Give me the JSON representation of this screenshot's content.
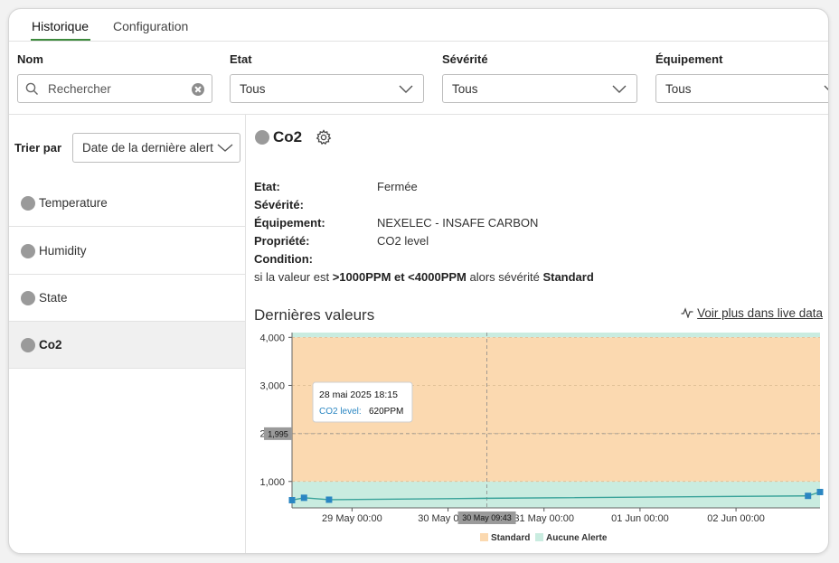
{
  "tabs": {
    "historique": "Historique",
    "configuration": "Configuration"
  },
  "filters": {
    "nom_label": "Nom",
    "etat_label": "Etat",
    "severite_label": "Sévérité",
    "equipement_label": "Équipement",
    "search_placeholder": "Rechercher",
    "etat_value": "Tous",
    "severite_value": "Tous",
    "equipement_value": "Tous"
  },
  "sidebar": {
    "sort_label": "Trier par",
    "sort_value": "Date de la dernière alerte",
    "items": [
      {
        "label": "Temperature"
      },
      {
        "label": "Humidity"
      },
      {
        "label": "State"
      },
      {
        "label": "Co2"
      }
    ]
  },
  "detail": {
    "title": "Co2",
    "etat_label": "Etat:",
    "etat_value": "Fermée",
    "severite_label": "Sévérité:",
    "equipement_label": "Équipement:",
    "equipement_value": "NEXELEC - INSAFE CARBON",
    "propriete_label": "Propriété:",
    "propriete_value": "CO2 level",
    "condition_label": "Condition:",
    "cond_prefix": "si la valeur est",
    "cond_range": ">1000PPM et <4000PPM",
    "cond_mid": "alors sévérité",
    "cond_severity": "Standard",
    "last_values_title": "Dernières valeurs",
    "live_link_icon": "activity-icon",
    "live_link": "Voir plus dans live data"
  },
  "colors": {
    "accent": "#3d8a3d",
    "standard_band": "#fbd9b0",
    "no_alert_band": "#c9ece0",
    "series": "#3aa39a",
    "marker": "#2a86c2",
    "tooltip_series": "#2a86c2"
  },
  "chart_data": {
    "type": "line",
    "x_ticks": [
      "29 May 00:00",
      "30 May 00:00",
      "31 May 00:00",
      "01 Jun 00:00",
      "02 Jun 00:00"
    ],
    "y_ticks": [
      "1,000",
      "2,000",
      "3,000",
      "4,000"
    ],
    "ylim": [
      450,
      4100
    ],
    "xlim": [
      "2025-05-28 09:00",
      "2025-06-02 21:00"
    ],
    "bands": [
      {
        "name": "Standard",
        "from": 1000,
        "to": 4000
      },
      {
        "name": "Aucune Alerte",
        "from": 450,
        "to": 1000
      },
      {
        "name": "Aucune Alerte",
        "from": 4000,
        "to": 4100
      }
    ],
    "series": [
      {
        "name": "CO2 level",
        "points": [
          {
            "x": "2025-05-28 09:00",
            "y": 610
          },
          {
            "x": "2025-05-28 12:00",
            "y": 660
          },
          {
            "x": "2025-05-28 18:15",
            "y": 620
          },
          {
            "x": "2025-05-30 09:43",
            "y": 650
          },
          {
            "x": "2025-06-02 18:00",
            "y": 700
          },
          {
            "x": "2025-06-02 21:00",
            "y": 780
          }
        ]
      }
    ],
    "legend": [
      "Standard",
      "Aucune Alerte"
    ],
    "legend_position": "bottom",
    "crosshair": {
      "x_label": "30 May 09:43",
      "y_label": "1,995"
    },
    "tooltip": {
      "date": "28 mai 2025 18:15",
      "series": "CO2 level",
      "value": "620PPM"
    },
    "grid": true
  }
}
